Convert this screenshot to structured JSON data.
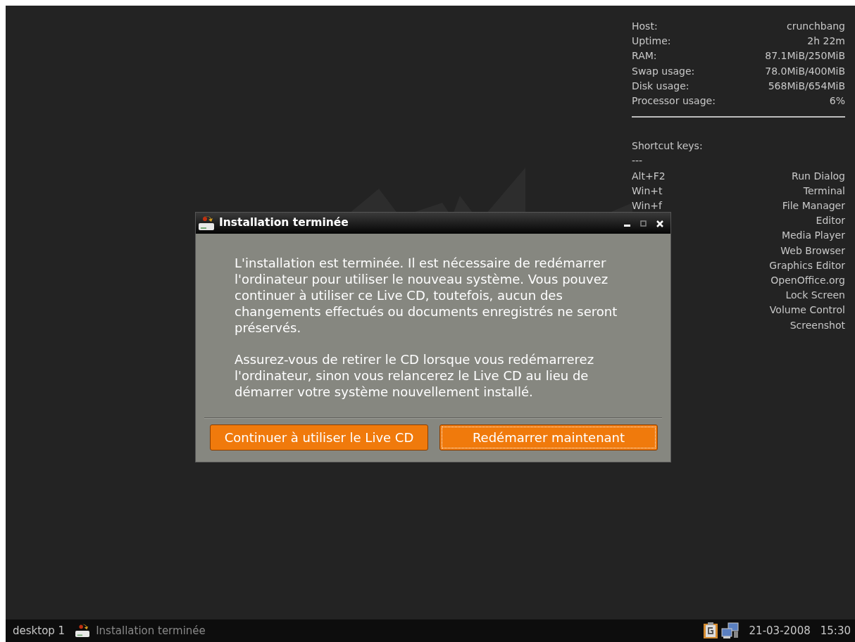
{
  "conky": {
    "stats": [
      {
        "label": "Host:",
        "value": "crunchbang"
      },
      {
        "label": "Uptime:",
        "value": "2h 22m"
      },
      {
        "label": "RAM:",
        "value": "87.1MiB/250MiB"
      },
      {
        "label": "Swap usage:",
        "value": "78.0MiB/400MiB"
      },
      {
        "label": "Disk usage:",
        "value": "568MiB/654MiB"
      },
      {
        "label": "Processor usage:",
        "value": "6%"
      }
    ],
    "shortcuts_heading": "Shortcut keys:",
    "separator": "---",
    "shortcuts": [
      {
        "key": "Alt+F2",
        "action": "Run Dialog"
      },
      {
        "key": "Win+t",
        "action": "Terminal"
      },
      {
        "key": "Win+f",
        "action": "File Manager"
      },
      {
        "action": "Editor"
      },
      {
        "action": "Media Player"
      },
      {
        "action": "Web Browser"
      },
      {
        "action": "Graphics Editor"
      },
      {
        "action": "OpenOffice.org"
      },
      {
        "action": "Lock Screen"
      },
      {
        "action": "Volume Control"
      },
      {
        "action": "Screenshot"
      }
    ]
  },
  "dialog": {
    "title": "Installation terminée",
    "paragraphs": [
      "L'installation est terminée. Il est nécessaire de redémarrer l'ordinateur pour utiliser le nouveau système. Vous pouvez continuer à utiliser ce Live CD, toutefois, aucun des changements effectués ou documents enregistrés ne seront préservés.",
      "Assurez-vous de retirer le CD lorsque vous redémarrerez l'ordinateur, sinon vous relancerez le Live CD au lieu de démarrer votre système nouvellement installé."
    ],
    "buttons": [
      {
        "label": "Continuer à utiliser le Live CD",
        "focused": false
      },
      {
        "label": "Redémarrer maintenant",
        "focused": true
      }
    ]
  },
  "taskbar": {
    "desktop": "desktop 1",
    "tasks": [
      {
        "title": "Installation terminée"
      }
    ],
    "date": "21-03-2008",
    "time": "15:30"
  }
}
